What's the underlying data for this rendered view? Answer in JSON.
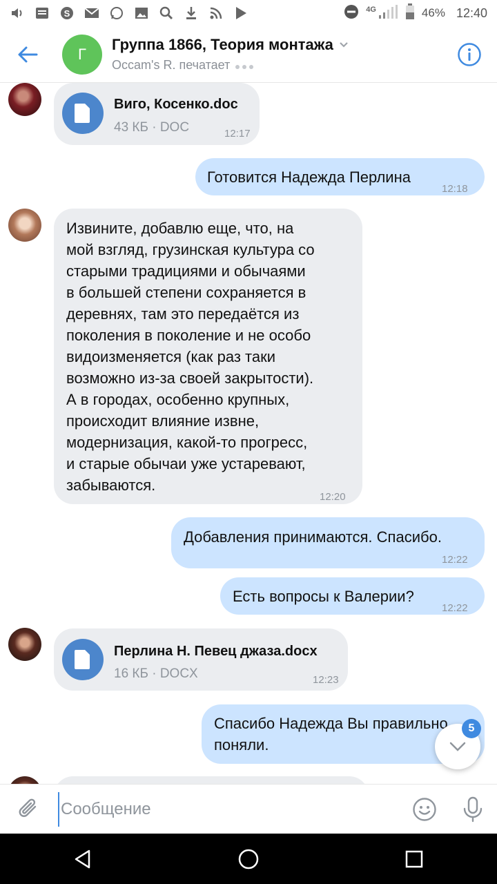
{
  "status_bar": {
    "left_icons": [
      "volume-icon",
      "news-icon",
      "skype-icon",
      "mail-icon",
      "whatsapp-icon",
      "gallery-icon",
      "search-icon",
      "download-icon",
      "rss-icon",
      "play-store-icon"
    ],
    "network": "4G",
    "battery": "46%",
    "clock": "12:40"
  },
  "header": {
    "avatar_letter": "Г",
    "title": "Группа 1866, Теория монтажа",
    "typing_status": "Occam's R. печатает"
  },
  "messages": [
    {
      "direction": "in",
      "type": "file",
      "file_name": "Виго, Косенко.doc",
      "file_meta": "43 КБ · DOC",
      "time": "12:17"
    },
    {
      "direction": "out",
      "type": "text",
      "text": "Готовится Надежда Перлина",
      "time": "12:18"
    },
    {
      "direction": "in",
      "type": "text",
      "lines": [
        "Извините, добавлю еще, что, на",
        "мой взгляд, грузинская культура со",
        "старыми традициями и обычаями",
        "в большей степени сохраняется в",
        "деревнях, там это передаётся из",
        "поколения в поколение и не особо",
        "видоизменяется (как раз таки",
        "возможно из-за своей закрытости).",
        "А в городах, особенно крупных,",
        "происходит влияние извне,",
        "модернизация, какой-то прогресс,",
        "и старые обычаи уже устаревают,",
        "забываются."
      ],
      "time": "12:20"
    },
    {
      "direction": "out",
      "type": "text",
      "text": "Добавления принимаются. Спасибо.",
      "time": "12:22"
    },
    {
      "direction": "out",
      "type": "text",
      "text": "Есть вопросы к Валерии?",
      "time": "12:22"
    },
    {
      "direction": "in",
      "type": "file",
      "file_name": "Перлина Н. Певец джаза.docx",
      "file_meta": "16 КБ · DOCX",
      "time": "12:23"
    },
    {
      "direction": "out",
      "type": "text",
      "lines": [
        "Спасибо Надежда Вы правильно",
        "поняли."
      ]
    }
  ],
  "scroll_down": {
    "unread_count": "5"
  },
  "composer": {
    "placeholder": "Сообщение"
  },
  "colors": {
    "accent": "#3f8ae0",
    "incoming_bubble": "#ebedf0",
    "outgoing_bubble": "#cce4ff",
    "group_avatar": "#5fc45a",
    "file_icon": "#4c86cc"
  }
}
